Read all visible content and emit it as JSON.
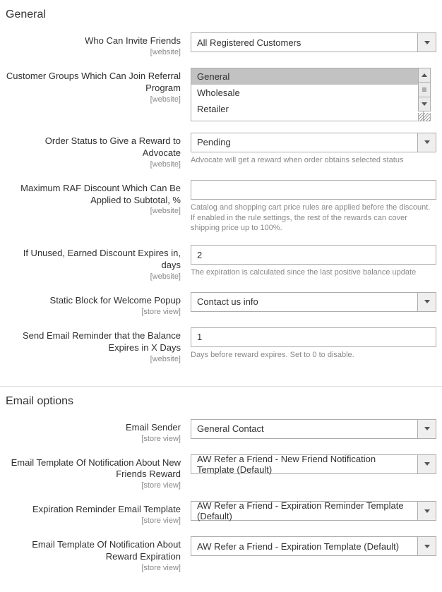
{
  "general": {
    "title": "General",
    "who_can_invite": {
      "label": "Who Can Invite Friends",
      "scope": "[website]",
      "value": "All Registered Customers"
    },
    "customer_groups": {
      "label": "Customer Groups Which Can Join Referral Program",
      "scope": "[website]",
      "options": [
        "General",
        "Wholesale",
        "Retailer"
      ],
      "selected": "General"
    },
    "order_status": {
      "label": "Order Status to Give a Reward to Advocate",
      "scope": "[website]",
      "value": "Pending",
      "help": "Advocate will get a reward when order obtains selected status"
    },
    "max_discount": {
      "label": "Maximum RAF Discount Which Can Be Applied to Subtotal, %",
      "scope": "[website]",
      "value": "",
      "help": "Catalog and shopping cart price rules are applied before the discount. If enabled in the rule settings, the rest of the rewards can cover shipping price up to 100%."
    },
    "expires_in": {
      "label": "If Unused, Earned Discount Expires in, days",
      "scope": "[website]",
      "value": "2",
      "help": "The expiration is calculated since the last positive balance update"
    },
    "static_block": {
      "label": "Static Block for Welcome Popup",
      "scope": "[store view]",
      "value": "Contact us info"
    },
    "reminder_days": {
      "label": "Send Email Reminder that the Balance Expires in X Days",
      "scope": "[website]",
      "value": "1",
      "help": "Days before reward expires. Set to 0 to disable."
    }
  },
  "email": {
    "title": "Email options",
    "sender": {
      "label": "Email Sender",
      "scope": "[store view]",
      "value": "General Contact"
    },
    "tpl_new_friend": {
      "label": "Email Template Of Notification About New Friends Reward",
      "scope": "[store view]",
      "value": "AW Refer a Friend - New Friend Notification Template (Default)"
    },
    "tpl_exp_reminder": {
      "label": "Expiration Reminder Email Template",
      "scope": "[store view]",
      "value": "AW Refer a Friend - Expiration Reminder Template (Default)"
    },
    "tpl_reward_exp": {
      "label": "Email Template Of Notification About Reward Expiration",
      "scope": "[store view]",
      "value": "AW Refer a Friend - Expiration Template (Default)"
    }
  }
}
